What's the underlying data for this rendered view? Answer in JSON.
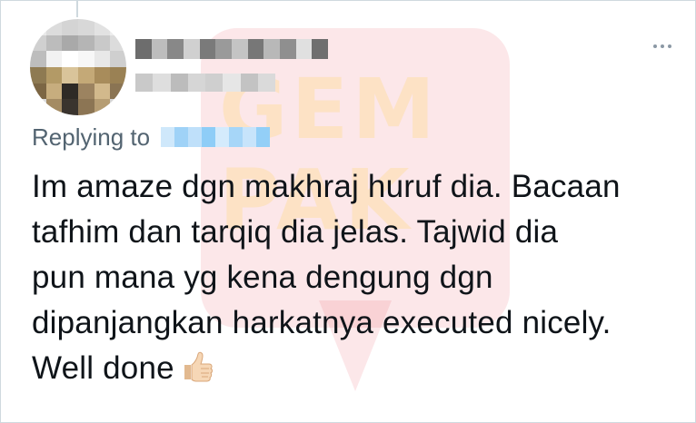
{
  "tweet": {
    "reply_prefix": "Replying to",
    "text_lines": [
      "Im amaze dgn makhraj huruf dia. Bacaan",
      "tafhim dan tarqiq dia jelas. Tajwid dia",
      "pun mana yg kena dengung dgn",
      "dipanjangkan harkatnya executed nicely.",
      "Well done"
    ],
    "emoji": "thumbs-up-icon"
  },
  "watermark": {
    "text_line_1": "GEM",
    "text_line_2": "PAK"
  },
  "colors": {
    "text": "#0f1419",
    "secondary_text": "#536471",
    "border": "#cfd9de",
    "link_blur": "#8ecdf7"
  }
}
